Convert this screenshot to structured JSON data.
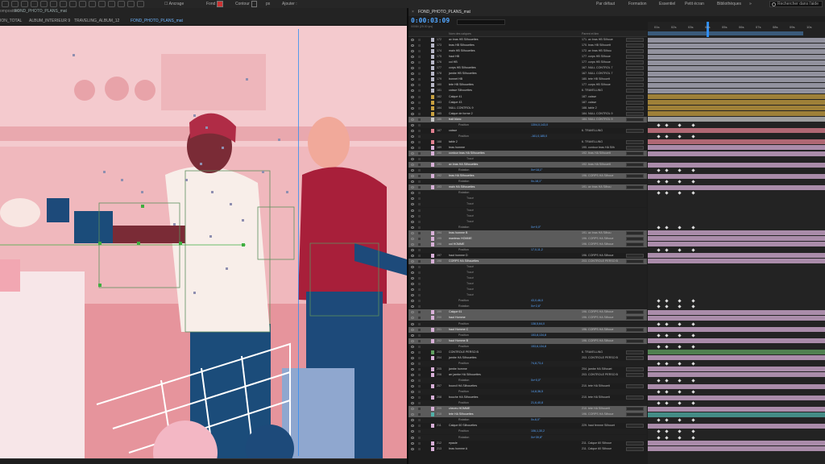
{
  "topbar": {
    "anchor_label": "Ancrage",
    "fill_label": "Fond",
    "stroke_label": "Contour",
    "stroke_width": "px",
    "add_label": "Ajouter :",
    "workspaces": [
      "Par défaut",
      "Formation",
      "Essentiel",
      "Petit écran",
      "Bibliothèques"
    ],
    "search_placeholder": "Rechercher dans l'aide"
  },
  "comp_panel": {
    "label": "omposition",
    "title": "FOND_PHOTO_PLANS_mat",
    "tabs": [
      "ION_TOTAL",
      "ALBUM_INTERIEUR 9",
      "TRAVELING_ALBUM_12",
      "FOND_PHOTO_PLANS_mat"
    ]
  },
  "timeline": {
    "tab_title": "FOND_PHOTO_PLANS_mat",
    "timecode": "0:00:03:09",
    "fps": "00084 (25.00 ips)",
    "col_name": "Nom des calques",
    "col_parent": "Parent et lien",
    "ruler_ticks": [
      "01s",
      "02s",
      "03s",
      "04s",
      "05s",
      "06s",
      "07s",
      "08s",
      "09s",
      "10s"
    ],
    "colors": {
      "accent": "#2f8df2",
      "value": "#58a6ff"
    },
    "rows": [
      {
        "n": "172",
        "name": "av bras HB Silhouettes",
        "parent": "171. av bras HB Silhoue",
        "color": "#b8b8c8",
        "type": "layer"
      },
      {
        "n": "173",
        "name": "bras HB Silhouettes",
        "parent": "170. bras HB Silhouett",
        "color": "#b8b8c8",
        "type": "layer"
      },
      {
        "n": "174",
        "name": "main HB Silhouettes",
        "parent": "172. av bras HB Silhou",
        "color": "#b8b8c8",
        "type": "layer"
      },
      {
        "n": "175",
        "name": "haut HB",
        "parent": "177. corps HB Silhoue",
        "color": "#b8b8c8",
        "type": "layer"
      },
      {
        "n": "176",
        "name": "col HB",
        "parent": "177. corps HB Silhoue",
        "color": "#b8b8c8",
        "type": "layer"
      },
      {
        "n": "177",
        "name": "corps HB Silhouettes",
        "parent": "167. NULL CONTROL 7",
        "color": "#b8b8c8",
        "type": "layer"
      },
      {
        "n": "178",
        "name": "jambe HB Silhouettes",
        "parent": "167. NULL CONTROL 7",
        "color": "#b8b8c8",
        "type": "layer"
      },
      {
        "n": "179",
        "name": "bonnet HB",
        "parent": "180. tete HB Silhouett",
        "color": "#b8b8c8",
        "type": "layer"
      },
      {
        "n": "180",
        "name": "tete HB Silhouettes",
        "parent": "177. corps HB Silhoue",
        "color": "#b8b8c8",
        "type": "layer"
      },
      {
        "n": "181",
        "name": "caisse Silhouettes",
        "parent": "6. TRAVELLING",
        "color": "#b8b8c8",
        "type": "layer"
      },
      {
        "n": "182",
        "name": "Calque 41",
        "parent": "187. caisse",
        "color": "#c8a040",
        "type": "layer"
      },
      {
        "n": "183",
        "name": "Calque 43",
        "parent": "187. caisse",
        "color": "#c8a040",
        "type": "layer"
      },
      {
        "n": "184",
        "name": "NULL CONTROL 9",
        "parent": "188. table 2",
        "color": "#c8a040",
        "type": "layer"
      },
      {
        "n": "185",
        "name": "Calque de forme 2",
        "parent": "184. NULL CONTROL 9",
        "color": "#c8a040",
        "type": "layer"
      },
      {
        "n": "186",
        "name": "trait blanc",
        "parent": "184. NULL CONTROL 9",
        "color": "#c8c8c8",
        "type": "hl"
      },
      {
        "n": "",
        "name": "Position",
        "value": "1304,0,143,0",
        "parent": "",
        "color": "",
        "type": "prop"
      },
      {
        "n": "187",
        "name": "caisse",
        "parent": "6. TRAVELLING",
        "color": "#e08090",
        "type": "layer"
      },
      {
        "n": "",
        "name": "Position",
        "value": "-161,0,185,0",
        "parent": "",
        "color": "",
        "type": "prop"
      },
      {
        "n": "188",
        "name": "table 2",
        "parent": "6. TRAVELLING",
        "color": "#e08090",
        "type": "layer"
      },
      {
        "n": "189",
        "name": "bras homme",
        "parent": "190. contour bras HA Silh",
        "color": "#d8b0d8",
        "type": "layer"
      },
      {
        "n": "190",
        "name": "contour bras HA Silhouettes",
        "parent": "192. bras HA Silhouett",
        "color": "#d8b0d8",
        "type": "hl"
      },
      {
        "n": "",
        "name": "Tracé",
        "value": "",
        "parent": "",
        "color": "",
        "type": "prop2"
      },
      {
        "n": "191",
        "name": "av bras HA Silhouettes",
        "parent": "192. bras HA Silhouett",
        "color": "#d8b0d8",
        "type": "hl"
      },
      {
        "n": "",
        "name": "Rotation",
        "value": "0x+18,1°",
        "parent": "",
        "color": "",
        "type": "prop"
      },
      {
        "n": "192",
        "name": "bras HA Silhouettes",
        "parent": "196. CORPS HA Silhoue",
        "color": "#d8b0d8",
        "type": "hl"
      },
      {
        "n": "",
        "name": "Rotation",
        "value": "0x-18,1°",
        "parent": "",
        "color": "",
        "type": "prop"
      },
      {
        "n": "193",
        "name": "main HA Silhouettes",
        "parent": "191. av bras HA Silhou",
        "color": "#d8b0d8",
        "type": "hl"
      },
      {
        "n": "",
        "name": "Rotation",
        "value": "",
        "parent": "",
        "color": "",
        "type": "prop"
      },
      {
        "n": "",
        "name": "Tracé",
        "value": "",
        "parent": "",
        "color": "",
        "type": "prop2"
      },
      {
        "n": "",
        "name": "Tracé",
        "value": "",
        "parent": "",
        "color": "",
        "type": "prop2"
      },
      {
        "n": "",
        "name": "Tracé",
        "value": "",
        "parent": "",
        "color": "",
        "type": "prop2"
      },
      {
        "n": "",
        "name": "Tracé",
        "value": "",
        "parent": "",
        "color": "",
        "type": "prop2"
      },
      {
        "n": "",
        "name": "Tracé",
        "value": "",
        "parent": "",
        "color": "",
        "type": "prop2"
      },
      {
        "n": "",
        "name": "Rotation",
        "value": "0x+0,0°",
        "parent": "",
        "color": "",
        "type": "prop"
      },
      {
        "n": "194",
        "name": "bras homme B",
        "parent": "191. av bras HA Silhou",
        "color": "#d8b0d8",
        "type": "hl"
      },
      {
        "n": "195",
        "name": "manteau HOMME",
        "parent": "196. CORPS HA Silhoue",
        "color": "#d8b0d8",
        "type": "hl"
      },
      {
        "n": "196",
        "name": "col HOMME",
        "parent": "196. CORPS HA Silhoue",
        "color": "#d8b0d8",
        "type": "hl"
      },
      {
        "n": "",
        "name": "Position",
        "value": "17,0,11,2",
        "parent": "",
        "color": "",
        "type": "prop"
      },
      {
        "n": "197",
        "name": "haut homme D",
        "parent": "196. CORPS HA Silhoue",
        "color": "#d8b0d8",
        "type": "layer"
      },
      {
        "n": "198",
        "name": "CORPS HA Silhouettes",
        "parent": "203. CONTROLE PERSO B",
        "color": "#d8b0d8",
        "type": "hl"
      },
      {
        "n": "",
        "name": "Tracé",
        "value": "",
        "parent": "",
        "color": "",
        "type": "prop2"
      },
      {
        "n": "",
        "name": "Tracé",
        "value": "",
        "parent": "",
        "color": "",
        "type": "prop2"
      },
      {
        "n": "",
        "name": "Tracé",
        "value": "",
        "parent": "",
        "color": "",
        "type": "prop2"
      },
      {
        "n": "",
        "name": "Tracé",
        "value": "",
        "parent": "",
        "color": "",
        "type": "prop2"
      },
      {
        "n": "",
        "name": "Tracé",
        "value": "",
        "parent": "",
        "color": "",
        "type": "prop2"
      },
      {
        "n": "",
        "name": "Tracé",
        "value": "",
        "parent": "",
        "color": "",
        "type": "prop2"
      },
      {
        "n": "",
        "name": "Position",
        "value": "43,0,46,0",
        "parent": "",
        "color": "",
        "type": "prop"
      },
      {
        "n": "",
        "name": "Rotation",
        "value": "0x+2,6°",
        "parent": "",
        "color": "",
        "type": "prop"
      },
      {
        "n": "199",
        "name": "Calque 61",
        "parent": "196. CORPS HA Silhoue",
        "color": "#d8b0d8",
        "type": "hl"
      },
      {
        "n": "200",
        "name": "haut Homme",
        "parent": "196. CORPS HA Silhoue",
        "color": "#d8b0d8",
        "type": "hl"
      },
      {
        "n": "",
        "name": "Position",
        "value": "138,5,64,0",
        "parent": "",
        "color": "",
        "type": "prop"
      },
      {
        "n": "201",
        "name": "haut Homme C",
        "parent": "196. CORPS HA Silhoue",
        "color": "#d8b0d8",
        "type": "hl"
      },
      {
        "n": "",
        "name": "Position",
        "value": "153,8,134,8",
        "parent": "",
        "color": "",
        "type": "prop"
      },
      {
        "n": "202",
        "name": "haut Homme B",
        "parent": "196. CORPS HA Silhoue",
        "color": "#d8b0d8",
        "type": "hl"
      },
      {
        "n": "",
        "name": "Position",
        "value": "153,6,134,8",
        "parent": "",
        "color": "",
        "type": "prop"
      },
      {
        "n": "203",
        "name": "CONTROLE PERSO B",
        "parent": "6. TRAVELLING",
        "color": "#60a060",
        "type": "layer"
      },
      {
        "n": "204",
        "name": "jambe HA Silhouettes",
        "parent": "203. CONTROLE PERSO B",
        "color": "#d8b0d8",
        "type": "layer"
      },
      {
        "n": "",
        "name": "Position",
        "value": "74,8,73,4",
        "parent": "",
        "color": "",
        "type": "prop"
      },
      {
        "n": "205",
        "name": "jambe homme",
        "parent": "204. jambe HA Silhouet",
        "color": "#d8b0d8",
        "type": "layer"
      },
      {
        "n": "206",
        "name": "arr jambe HA Silhouettes",
        "parent": "203. CONTROLE PERSO B",
        "color": "#d8b0d8",
        "type": "layer"
      },
      {
        "n": "",
        "name": "Rotation",
        "value": "0x+0,0°",
        "parent": "",
        "color": "",
        "type": "prop"
      },
      {
        "n": "207",
        "name": "bourcil HA Silhouettes",
        "parent": "210. tete HA Silhouett",
        "color": "#d8b0d8",
        "type": "layer"
      },
      {
        "n": "",
        "name": "Position",
        "value": "14,8,36,5",
        "parent": "",
        "color": "",
        "type": "prop"
      },
      {
        "n": "208",
        "name": "bouche HA Silhouettes",
        "parent": "210. tete HA Silhouett",
        "color": "#d8b0d8",
        "type": "layer"
      },
      {
        "n": "",
        "name": "Position",
        "value": "21,6,40,8",
        "parent": "",
        "color": "",
        "type": "prop"
      },
      {
        "n": "209",
        "name": "cheveu HOMME",
        "parent": "210. tete HA Silhouett",
        "color": "#d8b0d8",
        "type": "hl"
      },
      {
        "n": "210",
        "name": "tete HA Silhouettes",
        "parent": "196. CORPS HA Silhoue",
        "color": "#50b0a8",
        "type": "hl"
      },
      {
        "n": "",
        "name": "Rotation",
        "value": "0x-6,0°",
        "parent": "",
        "color": "",
        "type": "prop"
      },
      {
        "n": "211",
        "name": "Calque 60 Silhouettes",
        "parent": "229. haut femme Silhouet",
        "color": "#d8b0d8",
        "type": "layer"
      },
      {
        "n": "",
        "name": "Position",
        "value": "106,1,30,2",
        "parent": "",
        "color": "",
        "type": "prop"
      },
      {
        "n": "",
        "name": "Rotation",
        "value": "0x+39,8°",
        "parent": "",
        "color": "",
        "type": "prop"
      },
      {
        "n": "212",
        "name": "epaule",
        "parent": "211. Calque 60 Silhoue",
        "color": "#d8b0d8",
        "type": "layer"
      },
      {
        "n": "213",
        "name": "bras homme A",
        "parent": "211. Calque 60 Silhoue",
        "color": "#d8b0d8",
        "type": "layer"
      }
    ]
  }
}
